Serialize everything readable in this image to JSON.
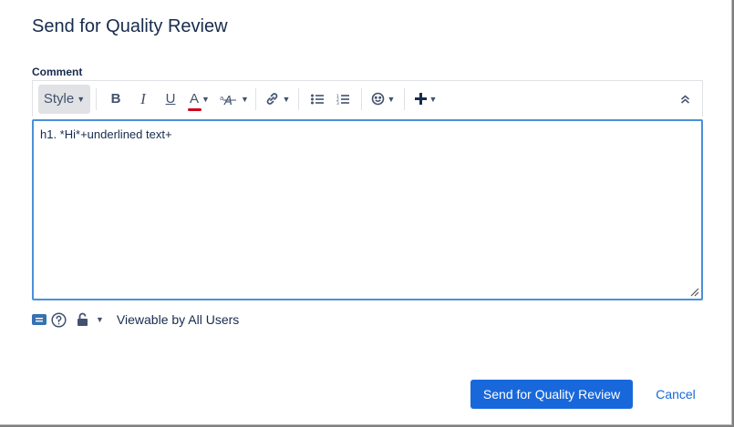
{
  "dialog": {
    "title": "Send for Quality Review",
    "comment_label": "Comment"
  },
  "toolbar": {
    "style_label": "Style",
    "bold_label": "B",
    "italic_label": "I",
    "underline_label": "U",
    "text_color_label": "A",
    "text_color_accent": "#d0021b",
    "icons": [
      "chevron-down-icon",
      "text-effects-icon",
      "link-icon",
      "bullet-list-icon",
      "numbered-list-icon",
      "emoji-icon",
      "plus-icon",
      "collapse-icon"
    ]
  },
  "editor": {
    "value": "h1. *Hi*+underlined text+"
  },
  "meta": {
    "visibility_text": "Viewable by All Users"
  },
  "footer": {
    "submit_label": "Send for Quality Review",
    "cancel_label": "Cancel"
  },
  "colors": {
    "primary": "#1868db",
    "focus_border": "#4a90d9",
    "text": "#172b4d"
  }
}
